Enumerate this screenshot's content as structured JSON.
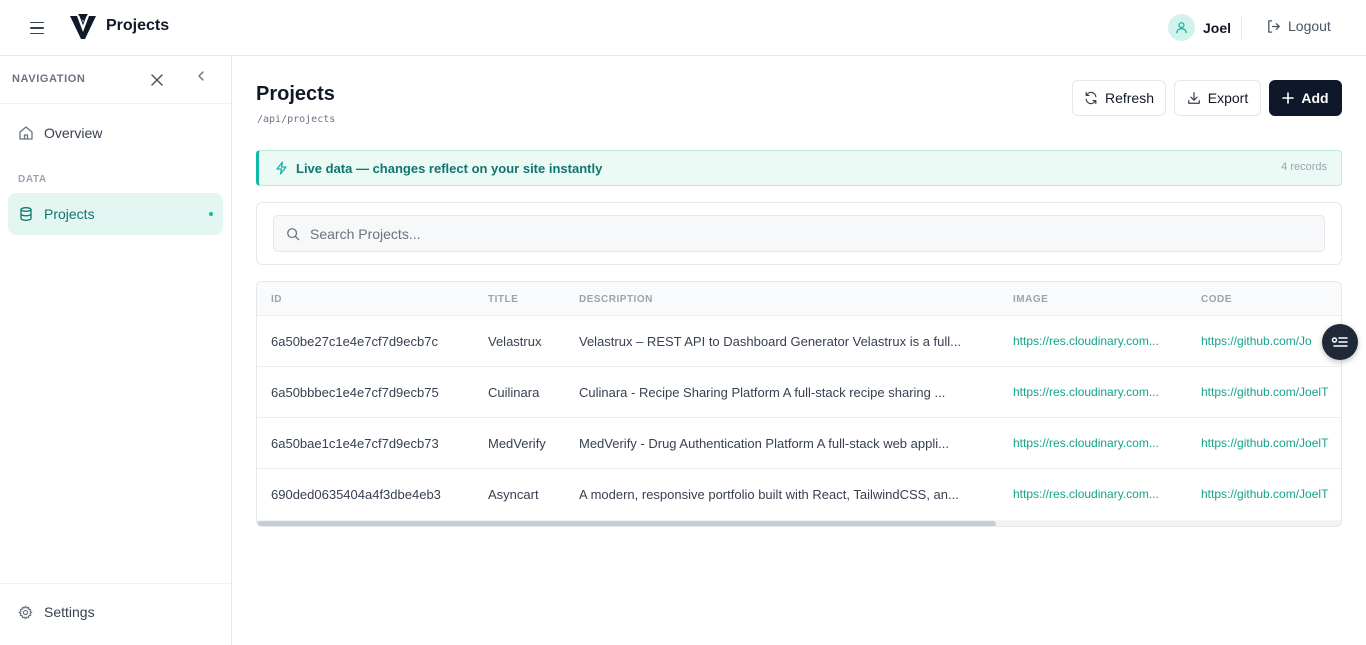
{
  "header": {
    "app_title": "Projects",
    "user_name": "Joel",
    "logout_label": "Logout"
  },
  "sidebar": {
    "nav_heading": "NAVIGATION",
    "overview_label": "Overview",
    "section_data": "DATA",
    "projects_label": "Projects",
    "settings_label": "Settings"
  },
  "main": {
    "title": "Projects",
    "path": "/api/projects",
    "refresh_label": "Refresh",
    "export_label": "Export",
    "add_label": "Add",
    "live_text": "Live data — changes reflect on your site instantly",
    "record_count": "4 records",
    "search_placeholder": "Search Projects..."
  },
  "table": {
    "columns": [
      "ID",
      "TITLE",
      "DESCRIPTION",
      "IMAGE",
      "CODE"
    ],
    "rows": [
      {
        "id": "6a50be27c1e4e7cf7d9ecb7c",
        "title": "Velastrux",
        "description": "Velastrux – REST API to Dashboard Generator Velastrux is a full...",
        "image": "https://res.cloudinary.com...",
        "code": "https://github.com/Jo"
      },
      {
        "id": "6a50bbbec1e4e7cf7d9ecb75",
        "title": "Cuilinara",
        "description": "Culinara - Recipe Sharing Platform A full-stack recipe sharing ...",
        "image": "https://res.cloudinary.com...",
        "code": "https://github.com/JoelT"
      },
      {
        "id": "6a50bae1c1e4e7cf7d9ecb73",
        "title": "MedVerify",
        "description": "MedVerify - Drug Authentication Platform A full-stack web appli...",
        "image": "https://res.cloudinary.com...",
        "code": "https://github.com/JoelT"
      },
      {
        "id": "690ded0635404a4f3dbe4eb3",
        "title": "Asyncart",
        "description": "A modern, responsive portfolio built with React, TailwindCSS, an...",
        "image": "https://res.cloudinary.com...",
        "code": "https://github.com/JoelT"
      }
    ]
  },
  "colors": {
    "accent": "#14b8a6",
    "accent_dark": "#0f766e",
    "primary_button": "#0f172a"
  },
  "icons": [
    "menu-icon",
    "logo-icon",
    "user-icon",
    "logout-icon",
    "close-icon",
    "chevron-left-icon",
    "home-icon",
    "database-icon",
    "gear-icon",
    "refresh-icon",
    "download-icon",
    "plus-icon",
    "lightning-icon",
    "search-icon",
    "filter-list-icon"
  ]
}
